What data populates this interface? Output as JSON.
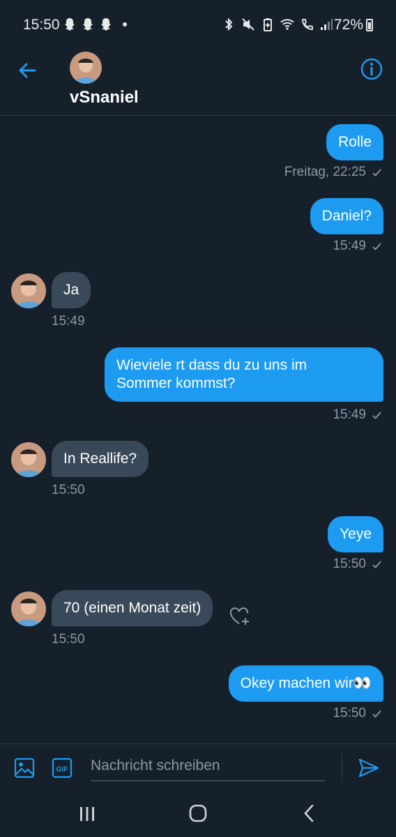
{
  "status_bar": {
    "time": "15:50",
    "battery": "72%",
    "notification_icons": [
      "snapchat-icon",
      "snapchat-icon",
      "snapchat-icon"
    ],
    "system_icons": [
      "bluetooth-icon",
      "mute-icon",
      "battery-saver-icon",
      "wifi-icon",
      "wifi-call-icon",
      "signal-icon"
    ]
  },
  "header": {
    "contact_name": "vSnaniel",
    "back_icon": "arrow-left-icon",
    "info_icon": "info-icon"
  },
  "messages": [
    {
      "direction": "sent",
      "text": "Rolle",
      "timestamp": "Freitag, 22:25",
      "read": true
    },
    {
      "direction": "sent",
      "text": "Daniel?",
      "timestamp": "15:49",
      "read": true
    },
    {
      "direction": "received",
      "text": "Ja",
      "timestamp": "15:49"
    },
    {
      "direction": "sent",
      "text_line1": "Wieviele rt dass du zu uns im",
      "text_line2": "Sommer kommst?",
      "timestamp": "15:49",
      "read": true
    },
    {
      "direction": "received",
      "text": "In Reallife?",
      "timestamp": "15:50"
    },
    {
      "direction": "sent",
      "text": "Yeye",
      "timestamp": "15:50",
      "read": true
    },
    {
      "direction": "received",
      "text": "70 (einen Monat zeit)",
      "timestamp": "15:50"
    },
    {
      "direction": "sent",
      "text": "Okey machen wir👀",
      "timestamp": "15:50",
      "read": true
    }
  ],
  "compose": {
    "placeholder": "Nachricht schreiben",
    "gif_label": "GIF"
  },
  "colors": {
    "background": "#15202b",
    "accent": "#1d9bf0",
    "received_bubble": "#3a4959",
    "secondary_text": "#8b98a5"
  }
}
